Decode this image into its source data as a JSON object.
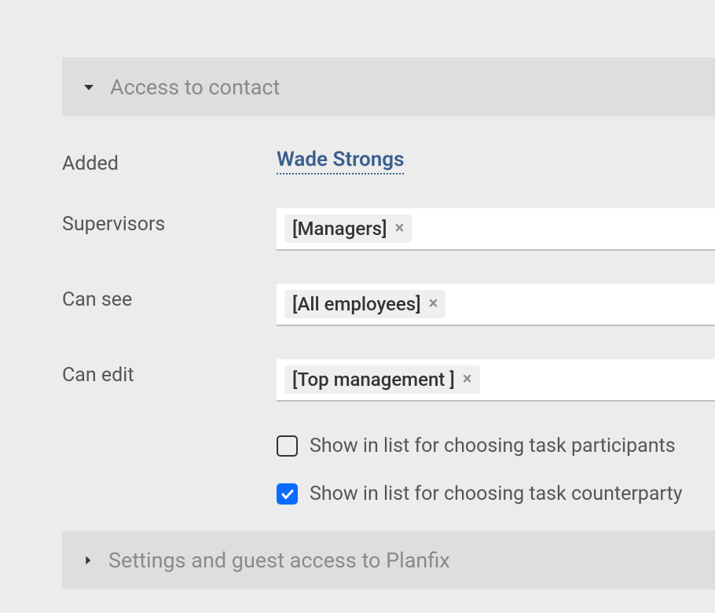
{
  "sections": {
    "access": {
      "title": "Access to contact",
      "expanded": true
    },
    "settings": {
      "title": "Settings and guest access to Planfix",
      "expanded": false
    }
  },
  "fields": {
    "added": {
      "label": "Added",
      "value": "Wade Strongs"
    },
    "supervisors": {
      "label": "Supervisors",
      "tags": [
        "[Managers]"
      ]
    },
    "can_see": {
      "label": "Can see",
      "tags": [
        "[All employees]"
      ]
    },
    "can_edit": {
      "label": "Can edit",
      "tags": [
        "[Top management ]"
      ]
    }
  },
  "checkboxes": {
    "show_participants": {
      "label": "Show in list for choosing task participants",
      "checked": false
    },
    "show_counterparty": {
      "label": "Show in list for choosing task counterparty",
      "checked": true
    }
  }
}
